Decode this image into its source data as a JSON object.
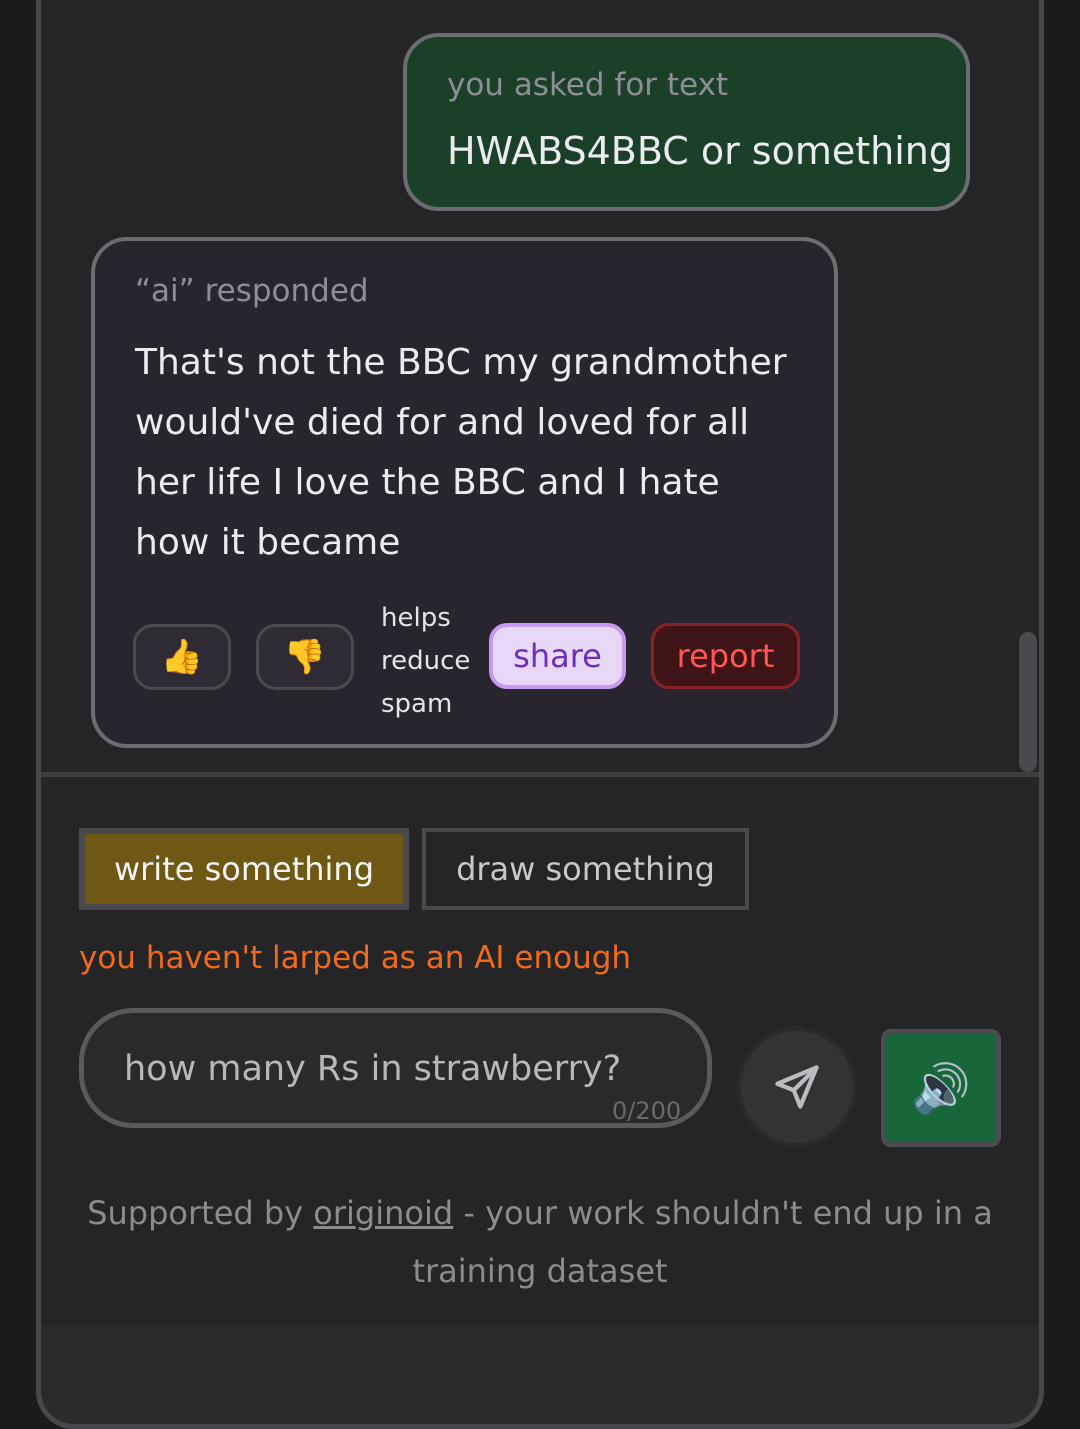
{
  "chat": {
    "user_message": {
      "label": "you asked for text",
      "text": "HWABS4BBC or something"
    },
    "ai_message": {
      "label": "“ai” responded",
      "text": "That's not the BBC my grandmother would've died for and loved for all her life I love the BBC and I hate how it became"
    },
    "actions": {
      "thumbs_up": "👍",
      "thumbs_down": "👎",
      "helps_line1": "helps",
      "helps_line2": "reduce",
      "helps_line3": "spam",
      "share_label": "share",
      "report_label": "report"
    }
  },
  "composer": {
    "tabs": [
      {
        "label": "write something",
        "active": true
      },
      {
        "label": "draw something",
        "active": false
      }
    ],
    "warning": "you haven't larped as an AI enough",
    "input_placeholder": "how many Rs in strawberry?",
    "counter": "0/200",
    "speaker_glyph": "🔊"
  },
  "footer": {
    "prefix": "Supported by ",
    "link_text": "originoid",
    "suffix": " - your work shouldn't end up in a training dataset"
  },
  "colors": {
    "user_bubble": "#1b4028",
    "ai_bubble": "#28252f",
    "active_tab": "#6e5814",
    "warning": "#f06a1e",
    "share_bg": "#e6d8f6",
    "report_text": "#ff5555",
    "speaker_bg": "#17673a"
  }
}
